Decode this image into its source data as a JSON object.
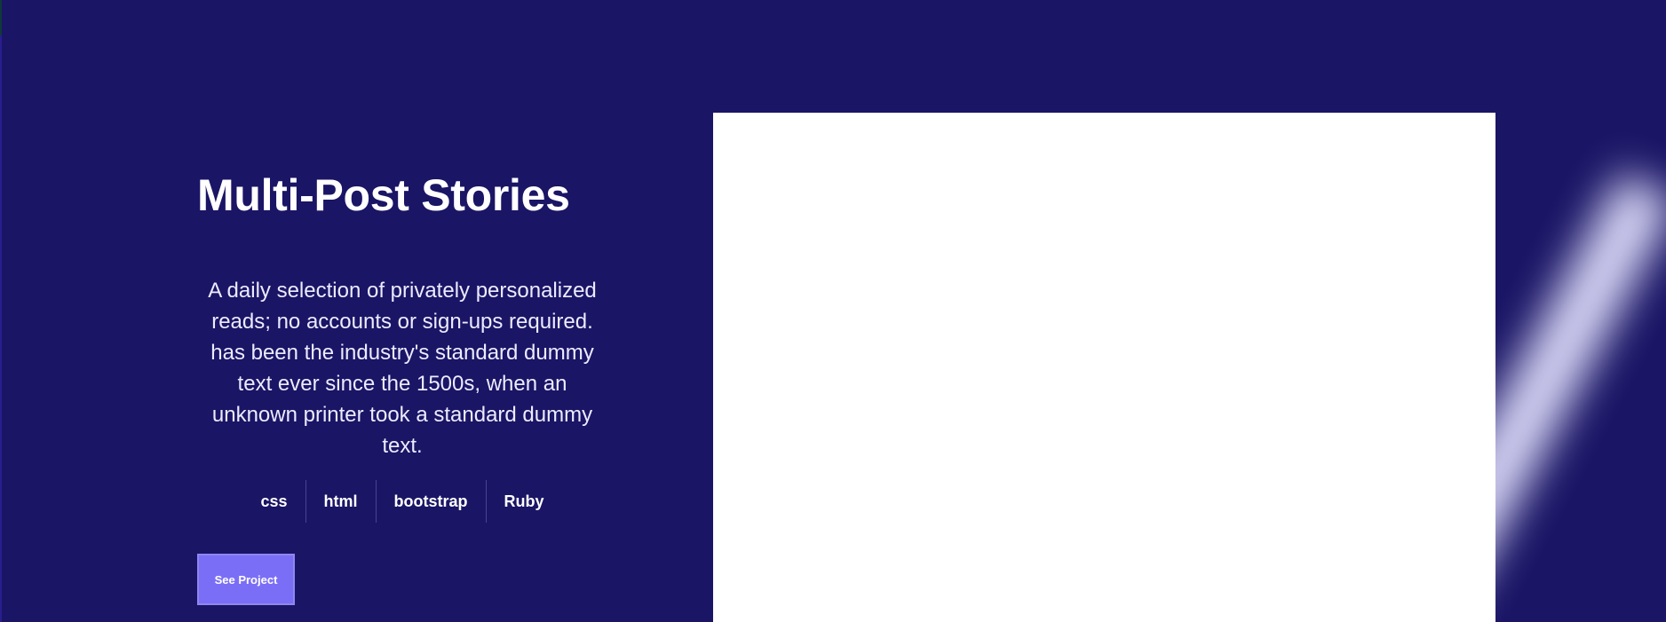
{
  "project": {
    "title": "Multi-Post Stories",
    "description": "A daily selection of privately personalized reads; no accounts or sign-ups required. has been the industry's standard dummy text ever since the 1500s, when an unknown printer took a standard dummy text.",
    "tags": [
      "css",
      "html",
      "bootstrap",
      "Ruby"
    ],
    "cta_label": "See Project"
  },
  "colors": {
    "background": "#1a1565",
    "accent": "#7b6ef6",
    "preview": "#ffffff",
    "glow": "#e4e3ff"
  }
}
